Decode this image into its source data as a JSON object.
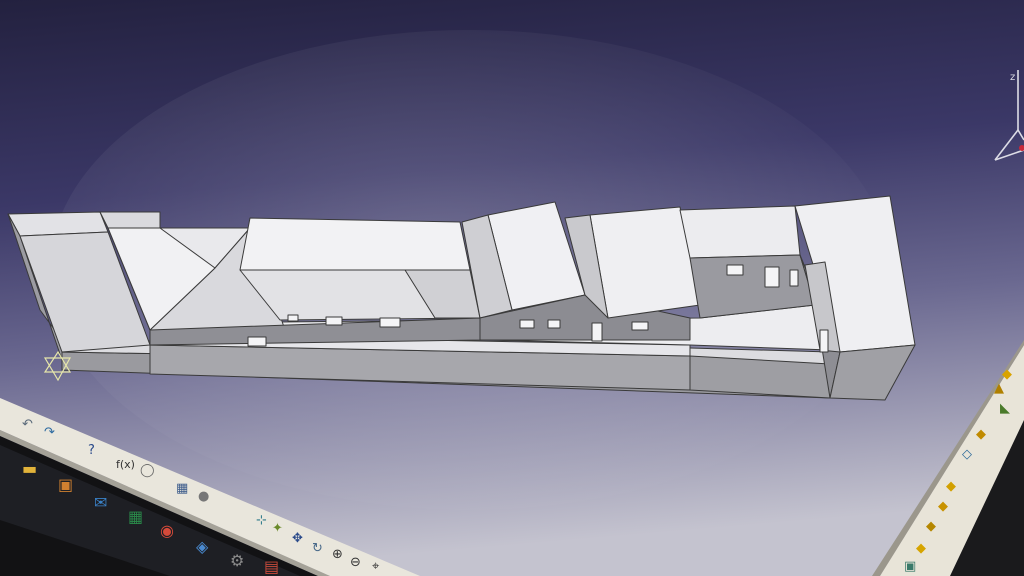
{
  "viewport": {
    "background_top": "#27254a",
    "background_mid": "#4a4878",
    "background_bottom": "#b9b8c8"
  },
  "model": {
    "face_light": "#ececee",
    "face_mid": "#d2d2d6",
    "face_dark": "#8f8f94",
    "edge": "#3a3a3a"
  },
  "compass": {
    "axis_label": "z",
    "accent": "#c8283a"
  },
  "workbench_toolbar": {
    "icons": [
      "part-icon",
      "pad-icon",
      "pocket-icon",
      "shaft-icon",
      "groove-icon",
      "hole-icon",
      "rib-icon",
      "slot-icon",
      "fillet-icon",
      "chamfer-icon",
      "draft-icon",
      "shell-icon",
      "thickness-icon",
      "split-icon",
      "close-surface-icon"
    ]
  },
  "bottom_toolbar": {
    "icons": [
      "undo-icon",
      "redo-icon",
      "help-icon",
      "formula-icon",
      "comment-icon",
      "image-icon",
      "sphere-icon",
      "select-icon",
      "fly-icon",
      "pan-icon",
      "rotate-icon",
      "zoom-in-icon",
      "zoom-out-icon",
      "normal-view-icon"
    ],
    "formula_label": "f(x)"
  },
  "taskbar": {
    "icons": [
      "file-explorer-icon",
      "store-icon",
      "mail-icon",
      "excel-icon",
      "chrome-icon",
      "app-icon",
      "settings-icon",
      "calendar-icon"
    ]
  }
}
